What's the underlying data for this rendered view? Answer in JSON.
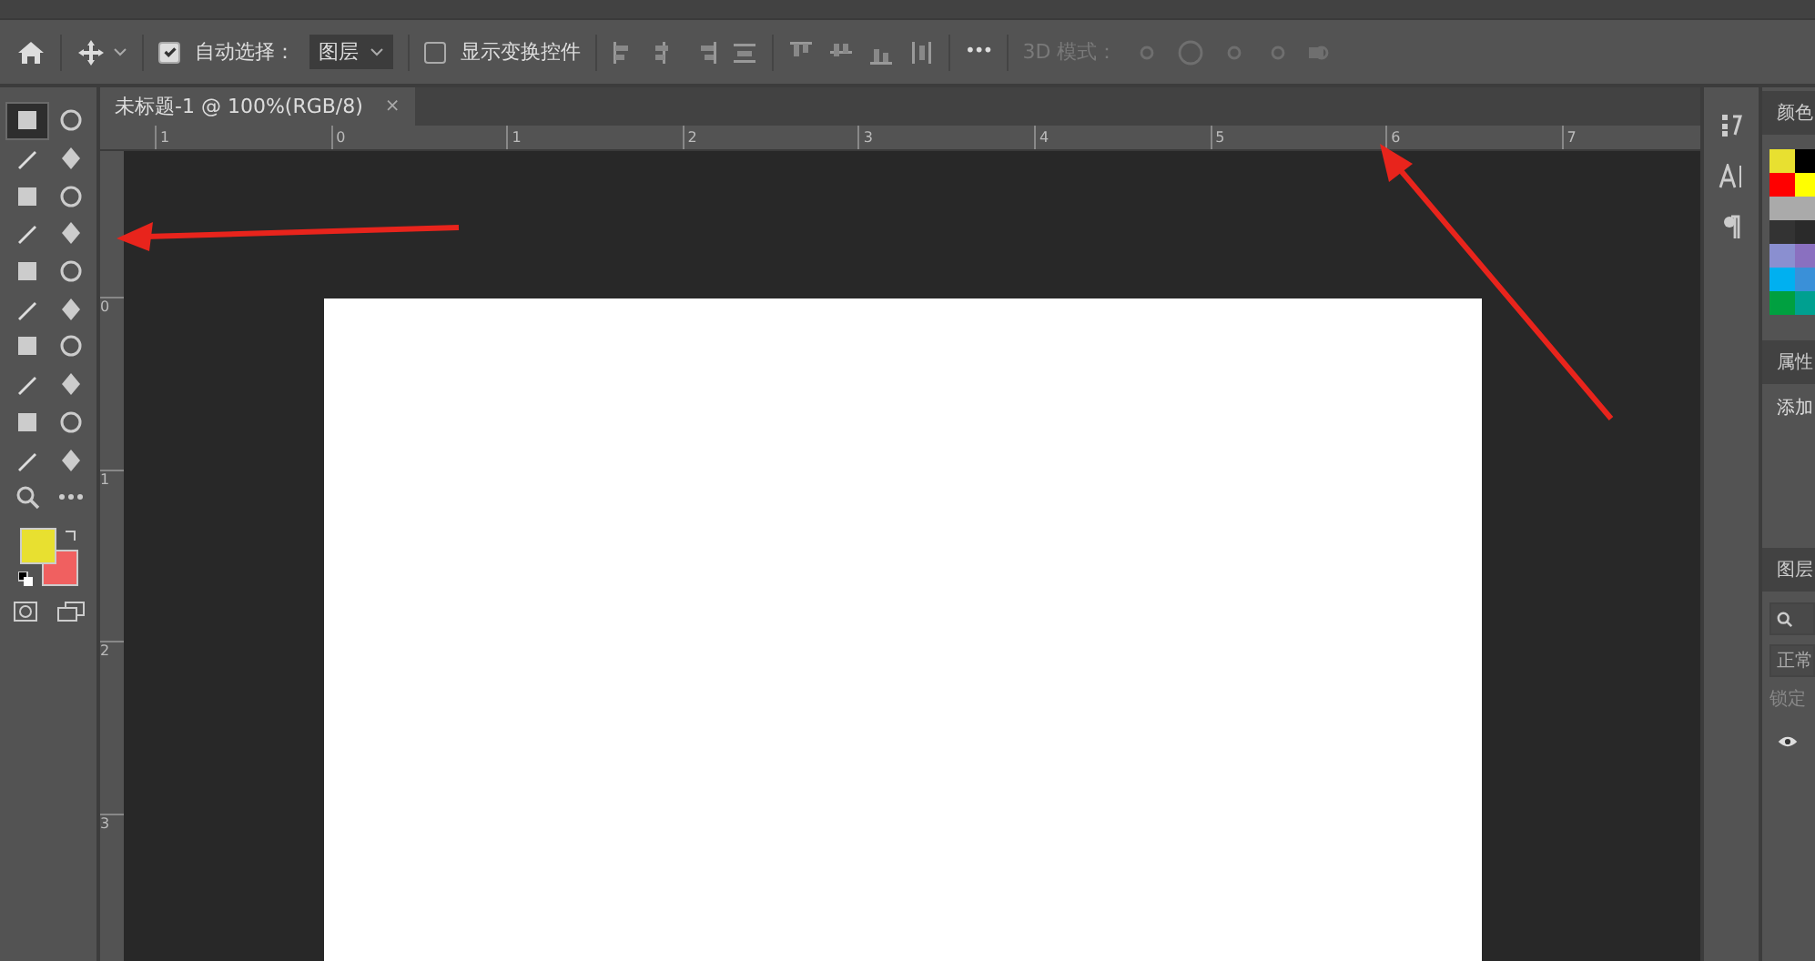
{
  "options_bar": {
    "auto_select": {
      "label": "自动选择：",
      "checked": true
    },
    "layer_dropdown": {
      "value": "图层"
    },
    "show_transform": {
      "label": "显示变换控件",
      "checked": false
    },
    "more": "•••",
    "mode_3d": {
      "label": "3D 模式：",
      "disabled": true
    }
  },
  "document_tab": {
    "title": "未标题-1 @ 100%(RGB/8)",
    "close": "×"
  },
  "ruler": {
    "horizontal": [
      "1",
      "0",
      "1",
      "2",
      "3",
      "4",
      "5",
      "6",
      "7"
    ],
    "vertical": [
      "0",
      "1",
      "2",
      "3"
    ]
  },
  "tools": [
    {
      "selected": true
    },
    {
      "selected": false
    },
    {
      "selected": false
    },
    {
      "selected": false
    },
    {
      "selected": false
    },
    {
      "selected": false
    },
    {
      "selected": false
    },
    {
      "selected": false
    },
    {
      "selected": false
    },
    {
      "selected": false
    },
    {
      "selected": false
    },
    {
      "selected": false
    },
    {
      "selected": false
    },
    {
      "selected": false
    },
    {
      "selected": false
    },
    {
      "selected": false
    },
    {
      "selected": false
    },
    {
      "selected": false
    },
    {
      "selected": false
    },
    {
      "selected": false
    }
  ],
  "colors": {
    "foreground": {
      "color": "#e8e030"
    },
    "background": {
      "color": "#f06060"
    }
  },
  "right_panel": {
    "color_title": "颜色",
    "swatches": [
      {
        "color": "#e8e030"
      },
      {
        "color": "#000000"
      },
      {
        "color": "#ff0000"
      },
      {
        "color": "#ffff00"
      },
      {
        "color": "#aaaaaa"
      },
      {
        "color": "#aaaaaa"
      },
      {
        "color": "#333333"
      },
      {
        "color": "#2a2a2a"
      },
      {
        "color": "#8a8fd0"
      },
      {
        "color": "#8a70c0"
      },
      {
        "color": "#00b0f0"
      },
      {
        "color": "#3a90d8"
      },
      {
        "color": "#00a040"
      },
      {
        "color": "#00a090"
      }
    ],
    "properties_title": "属性",
    "properties_text": "添加",
    "layers_title": "图层",
    "blend_mode": "正常",
    "lock_label": "锁定"
  }
}
